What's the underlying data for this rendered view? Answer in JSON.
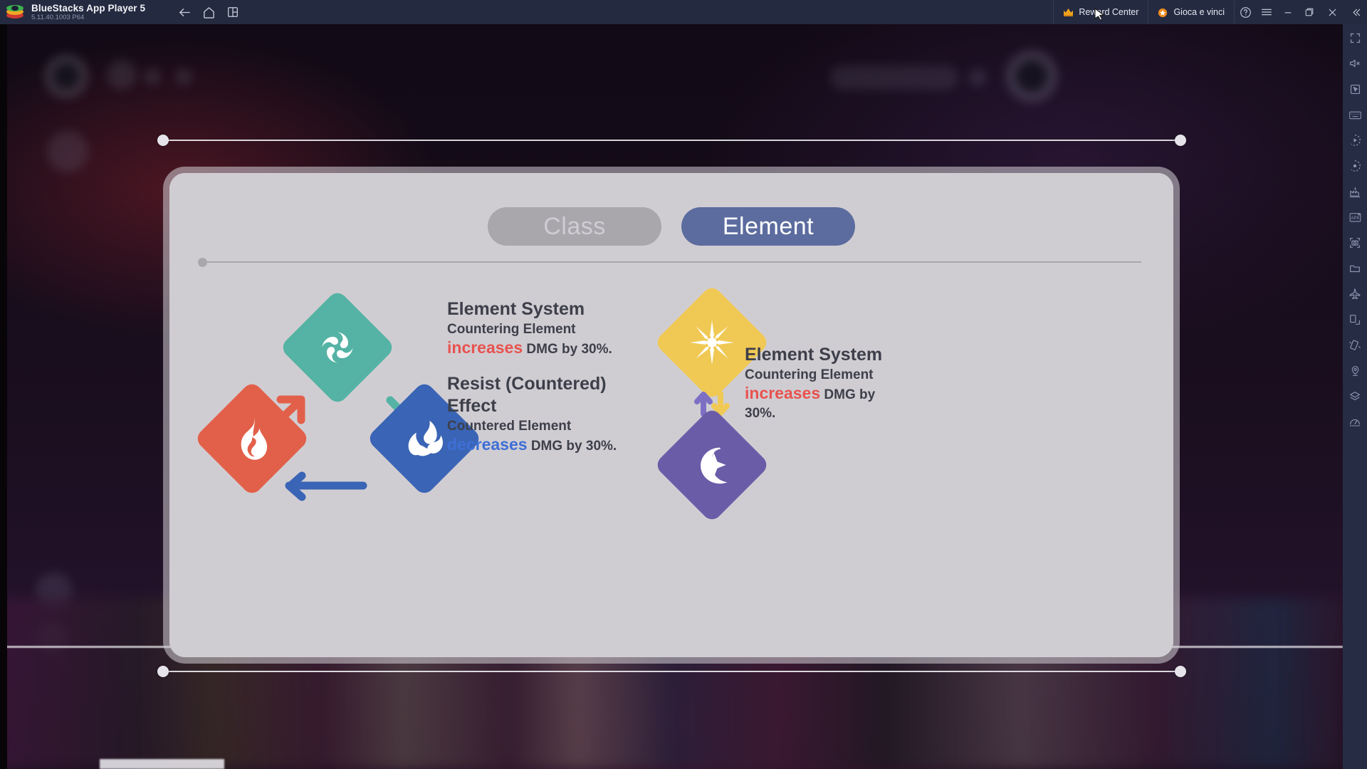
{
  "titlebar": {
    "app_title": "BlueStacks App Player 5",
    "version": "5.11.40.1003  P64",
    "nav": [
      {
        "name": "back-button",
        "icon": "arrow-left-icon"
      },
      {
        "name": "home-button",
        "icon": "home-icon"
      },
      {
        "name": "multi-instance-button",
        "icon": "windows-stack-icon"
      }
    ],
    "reward_center_label": "Reward Center",
    "gioca_e_vinci_label": "Gioca e vinci",
    "right_icons": [
      {
        "name": "help-button",
        "icon": "question-circle-icon"
      },
      {
        "name": "menu-button",
        "icon": "hamburger-menu-icon"
      },
      {
        "name": "minimize-button",
        "icon": "minimize-icon"
      },
      {
        "name": "maximize-button",
        "icon": "maximize-restore-icon"
      },
      {
        "name": "close-button",
        "icon": "close-icon"
      },
      {
        "name": "collapse-sidebar-button",
        "icon": "chevron-double-left-icon"
      }
    ],
    "bg_color": "#242a40"
  },
  "sidebar": {
    "items": [
      {
        "name": "fullscreen-button",
        "icon": "fullscreen-icon"
      },
      {
        "name": "mute-button",
        "icon": "speaker-mute-icon"
      },
      {
        "name": "cursor-control-button",
        "icon": "cursor-pointer-icon"
      },
      {
        "name": "game-controls-button",
        "icon": "keyboard-icon"
      },
      {
        "name": "macro-recorder-button",
        "icon": "record-play-icon"
      },
      {
        "name": "script-button",
        "icon": "record-dot-icon"
      },
      {
        "name": "eco-mode-button",
        "icon": "factory-icon"
      },
      {
        "name": "install-apk-button",
        "icon": "apk-plus-icon"
      },
      {
        "name": "screenshot-button",
        "icon": "camera-icon"
      },
      {
        "name": "media-manager-button",
        "icon": "folder-icon"
      },
      {
        "name": "airplane-mode-button",
        "icon": "airplane-icon"
      },
      {
        "name": "rotate-button",
        "icon": "rotate-screen-icon"
      },
      {
        "name": "shake-button",
        "icon": "shake-device-icon"
      },
      {
        "name": "location-button",
        "icon": "location-pin-icon"
      },
      {
        "name": "multi-instance-manager-button",
        "icon": "layers-icon"
      },
      {
        "name": "performance-button",
        "icon": "gauge-icon"
      }
    ],
    "bg_color": "#262c44"
  },
  "panel": {
    "tabs": [
      {
        "label": "Class",
        "active": false,
        "bg": "#a9a6ac",
        "fg": "#cfccd3"
      },
      {
        "label": "Element",
        "active": true,
        "bg": "#5c6c9f",
        "fg": "#ffffff"
      }
    ],
    "bg_color": "#d0cdd2"
  },
  "triangle": {
    "elements": [
      {
        "name": "wind",
        "icon": "wind-swirl-icon",
        "color": "#54b3a4"
      },
      {
        "name": "fire",
        "icon": "flame-icon",
        "color": "#e2604a"
      },
      {
        "name": "water",
        "icon": "water-droplet-icon",
        "color": "#3a64b5"
      }
    ],
    "arrows": [
      {
        "from": "fire",
        "to": "wind",
        "color": "#e2604a"
      },
      {
        "from": "wind",
        "to": "water",
        "color": "#54b3a4"
      },
      {
        "from": "water",
        "to": "fire",
        "color": "#3a64b5"
      }
    ]
  },
  "pair": {
    "elements": [
      {
        "name": "light",
        "icon": "sun-icon",
        "color": "#f0c955"
      },
      {
        "name": "dark",
        "icon": "moon-star-icon",
        "color": "#6b5ca8"
      }
    ],
    "arrow_up_color": "#7d6fc4",
    "arrow_down_color": "#f0c955"
  },
  "center_text": {
    "block1": {
      "title": "Element System",
      "sub": "Countering Element",
      "highlight": "increases",
      "rest": " DMG by 30%."
    },
    "block2": {
      "title_line1": "Resist (Countered)",
      "title_line2": "Effect",
      "sub": "Countered Element",
      "highlight": "decreases",
      "rest": " DMG by 30%."
    }
  },
  "right_text": {
    "title": "Element System",
    "sub": "Countering Element",
    "highlight": "increases",
    "rest": " DMG by",
    "rest2": "30%."
  },
  "colors": {
    "increase_red": "#e8534f",
    "decrease_blue": "#3e6fd6",
    "text_dark": "#3d3f4a",
    "panel_gray": "#d0cdd2",
    "accent_blue": "#5c6c9f"
  }
}
